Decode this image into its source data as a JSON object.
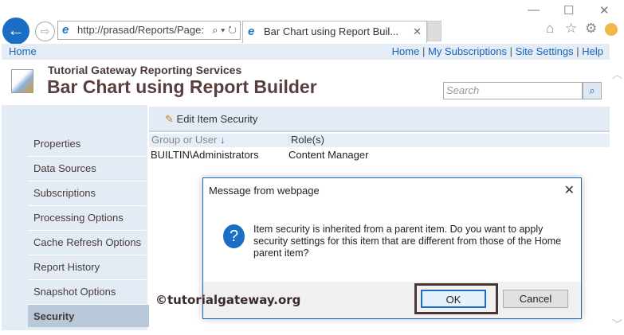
{
  "browser": {
    "url": "http://prasad/Reports/Page:",
    "tab_title": "Bar Chart using Report Buil...",
    "window_controls": [
      "minimize",
      "maximize",
      "close"
    ]
  },
  "topnav": {
    "left_link": "Home",
    "links": [
      "Home",
      "My Subscriptions",
      "Site Settings",
      "Help"
    ]
  },
  "header": {
    "subtitle": "Tutorial Gateway Reporting Services",
    "title": "Bar Chart using Report Builder",
    "search_placeholder": "Search"
  },
  "sidebar": {
    "items": [
      {
        "label": "Properties"
      },
      {
        "label": "Data Sources"
      },
      {
        "label": "Subscriptions"
      },
      {
        "label": "Processing Options"
      },
      {
        "label": "Cache Refresh Options"
      },
      {
        "label": "Report History"
      },
      {
        "label": "Snapshot Options"
      },
      {
        "label": "Security",
        "selected": true
      }
    ]
  },
  "toolbar": {
    "edit_label": "Edit Item Security"
  },
  "table": {
    "columns": [
      "Group or User",
      "Role(s)"
    ],
    "rows": [
      [
        "BUILTIN\\Administrators",
        "Content Manager"
      ]
    ]
  },
  "dialog": {
    "title": "Message from webpage",
    "message": "Item security is inherited from a parent item. Do you want to apply security settings for this item that are different from those of the Home parent item?",
    "ok": "OK",
    "cancel": "Cancel"
  },
  "watermark": "©tutorialgateway.org"
}
